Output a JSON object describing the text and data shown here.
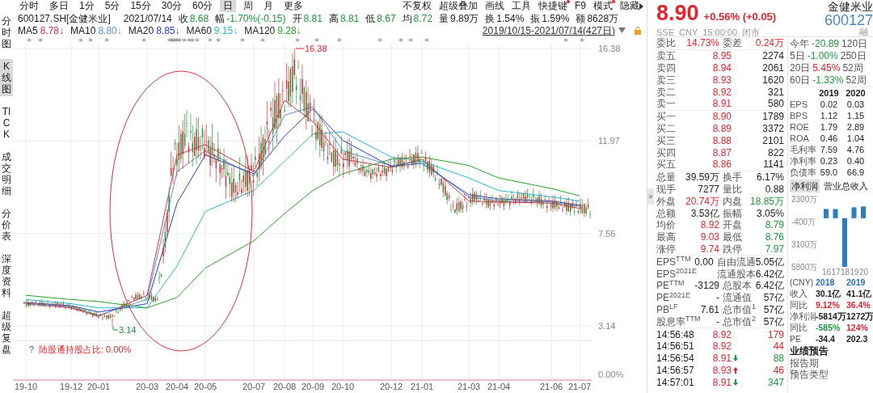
{
  "toolbar": {
    "periods": [
      {
        "label": "分时",
        "selected": false
      },
      {
        "label": "多日",
        "selected": false
      },
      {
        "label": "1分",
        "selected": false
      },
      {
        "label": "5分",
        "selected": false
      },
      {
        "label": "15分",
        "selected": false
      },
      {
        "label": "30分",
        "selected": false
      },
      {
        "label": "60分",
        "selected": false
      },
      {
        "label": "日",
        "selected": true
      },
      {
        "label": "周",
        "selected": false
      },
      {
        "label": "月",
        "selected": false
      },
      {
        "label": "更多",
        "selected": false
      }
    ],
    "tools": [
      {
        "label": "不复权",
        "dot": false,
        "caret": false
      },
      {
        "label": "超级叠加",
        "dot": false,
        "caret": false
      },
      {
        "label": "画线",
        "dot": false,
        "caret": false
      },
      {
        "label": "工具",
        "dot": false,
        "caret": false
      },
      {
        "label": "快捷键",
        "dot": true,
        "caret": false
      },
      {
        "label": "F9",
        "dot": false,
        "caret": false
      },
      {
        "label": "模式",
        "dot": true,
        "caret": false
      },
      {
        "label": "隐藏",
        "dot": false,
        "caret": true
      }
    ]
  },
  "side_tabs": [
    {
      "label": "分时图",
      "selected": false
    },
    {
      "label": "K线图",
      "selected": true
    },
    {
      "label": "TICK",
      "selected": false
    },
    {
      "label": "成交明细",
      "selected": false
    },
    {
      "label": "分价表",
      "selected": false
    },
    {
      "label": "深度资料",
      "selected": false
    },
    {
      "label": "超级复盘",
      "selected": false
    }
  ],
  "quote": {
    "symbol": "600127.SH[金健米业]",
    "date": "2021/07/14",
    "items": [
      {
        "label": "收",
        "value": "8.68",
        "color": "#1c9a3c"
      },
      {
        "label": "幅",
        "value": "-1.70%(-0.15)",
        "color": "#1c9a3c"
      },
      {
        "label": "开",
        "value": "8.81",
        "color": "#1c9a3c"
      },
      {
        "label": "高",
        "value": "8.81",
        "color": "#1c9a3c"
      },
      {
        "label": "低",
        "value": "8.67",
        "color": "#1c9a3c"
      },
      {
        "label": "均",
        "value": "8.72",
        "color": "#1c9a3c"
      },
      {
        "label": "量",
        "value": "9.89万",
        "color": "#222222"
      },
      {
        "label": "换",
        "value": "1.54%",
        "color": "#222222"
      },
      {
        "label": "振",
        "value": "1.59%",
        "color": "#222222"
      },
      {
        "label": "额",
        "value": "8628万",
        "color": "#222222"
      }
    ]
  },
  "ma": [
    {
      "label": "MA5",
      "value": "8.78↓",
      "color": "#d9304f"
    },
    {
      "label": "MA10",
      "value": "8.80↓",
      "color": "#5b8fd8"
    },
    {
      "label": "MA20",
      "value": "8.85↓",
      "color": "#2a3fc8"
    },
    {
      "label": "MA60",
      "value": "9.15↓",
      "color": "#28b8d8"
    },
    {
      "label": "MA120",
      "value": "9.28↓",
      "color": "#2aa02a"
    }
  ],
  "range": "2019/10/15-2021/07/14(427日)",
  "kline": {
    "high_label": "16.38",
    "low_label": "3.14",
    "sub_help": "?",
    "sub_text": "陆股通持股占比: 0.00%",
    "sub_tick": "0.00%",
    "chart_data": {
      "type": "line",
      "categories": [
        "19-10",
        "19-12",
        "20-01",
        "20-03",
        "20-04",
        "20-05",
        "20-07",
        "20-08",
        "20-09",
        "20-10",
        "20-12",
        "21-01",
        "21-03",
        "21-04",
        "21-06",
        "21-07"
      ],
      "ylim": [
        3.14,
        16.38
      ],
      "yticks": [
        16.38,
        11.97,
        7.55,
        3.14
      ],
      "grid": true,
      "series": [
        {
          "color": "#d9304f",
          "values": [
            4.2,
            4.0,
            3.6,
            4.6,
            11.3,
            11.8,
            10.5,
            13.9,
            12.9,
            11.1,
            10.7,
            11.1,
            9.1,
            9.05,
            9.0,
            8.75
          ]
        },
        {
          "color": "#5b8fd8",
          "values": [
            4.2,
            4.05,
            3.65,
            4.4,
            10.5,
            11.5,
            10.3,
            13.2,
            13.6,
            11.5,
            10.8,
            11.0,
            9.3,
            9.1,
            9.05,
            8.85
          ]
        },
        {
          "color": "#2a3fc8",
          "values": [
            4.25,
            4.1,
            3.8,
            4.2,
            9.0,
            11.3,
            10.4,
            12.2,
            13.5,
            12.0,
            10.75,
            10.9,
            9.4,
            9.2,
            9.1,
            8.9
          ]
        },
        {
          "color": "#28b8d8",
          "values": [
            4.4,
            4.2,
            4.0,
            4.0,
            6.0,
            8.6,
            9.6,
            11.0,
            12.3,
            12.4,
            11.2,
            11.0,
            10.2,
            9.6,
            9.3,
            9.1
          ]
        },
        {
          "color": "#2aa02a",
          "values": [
            4.6,
            4.4,
            4.3,
            4.0,
            4.5,
            5.9,
            7.2,
            8.5,
            9.6,
            10.4,
            11.1,
            11.2,
            10.8,
            10.2,
            9.7,
            9.35
          ]
        }
      ]
    }
  },
  "collapse_handle": "»",
  "header": {
    "price": "8.90",
    "change": "+0.56% (+0.05)",
    "color": "#e3262e",
    "meta": "SSE  CNY  15:00:00  闭市",
    "name": "金健米业",
    "code": "600127",
    "badge": "融"
  },
  "order_book": {
    "ratio": {
      "left": {
        "label": "委比",
        "value": "14.73%",
        "color": "#e3262e"
      },
      "right": {
        "label": "委差",
        "value": "0.24万",
        "color": "#e3262e"
      }
    },
    "asks": [
      {
        "label": "卖五",
        "price": "8.95",
        "volume": "2274",
        "color": "#e3262e"
      },
      {
        "label": "卖四",
        "price": "8.94",
        "volume": "2061",
        "color": "#e3262e"
      },
      {
        "label": "卖三",
        "price": "8.93",
        "volume": "1620",
        "color": "#e3262e"
      },
      {
        "label": "卖二",
        "price": "8.92",
        "volume": "321",
        "color": "#e3262e"
      },
      {
        "label": "卖一",
        "price": "8.91",
        "volume": "580",
        "color": "#e3262e"
      }
    ],
    "bids": [
      {
        "label": "买一",
        "price": "8.90",
        "volume": "1789",
        "color": "#e3262e"
      },
      {
        "label": "买二",
        "price": "8.89",
        "volume": "3372",
        "color": "#e3262e"
      },
      {
        "label": "买三",
        "price": "8.88",
        "volume": "2101",
        "color": "#e3262e"
      },
      {
        "label": "买四",
        "price": "8.87",
        "volume": "822",
        "color": "#e3262e"
      },
      {
        "label": "买五",
        "price": "8.86",
        "volume": "1141",
        "color": "#e3262e"
      }
    ]
  },
  "stats": [
    {
      "left": {
        "label": "总量",
        "value": "39.59万",
        "color": "#222222"
      },
      "right": {
        "label": "换手",
        "value": "6.17%",
        "color": "#222222"
      }
    },
    {
      "left": {
        "label": "现手",
        "value": "7277",
        "color": "#222222"
      },
      "right": {
        "label": "量比",
        "value": "0.88",
        "color": "#222222"
      }
    },
    {
      "left": {
        "label": "外盘",
        "value": "20.74万",
        "color": "#e3262e"
      },
      "right": {
        "label": "内盘",
        "value": "18.85万",
        "color": "#1c9a3c"
      }
    },
    {
      "left": {
        "label": "总额",
        "value": "3.53亿",
        "color": "#222222"
      },
      "right": {
        "label": "振幅",
        "value": "3.05%",
        "color": "#222222"
      }
    },
    {
      "left": {
        "label": "均价",
        "value": "8.92",
        "color": "#e3262e"
      },
      "right": {
        "label": "开盘",
        "value": "8.79",
        "color": "#1c9a3c"
      }
    },
    {
      "left": {
        "label": "最高",
        "value": "9.03",
        "color": "#e3262e"
      },
      "right": {
        "label": "最低",
        "value": "8.76",
        "color": "#1c9a3c"
      }
    },
    {
      "left": {
        "label": "涨停",
        "value": "9.74",
        "color": "#e3262e"
      },
      "right": {
        "label": "跌停",
        "value": "7.97",
        "color": "#1c9a3c"
      }
    }
  ],
  "valuation": [
    {
      "left": {
        "label": "EPS$^{TTM}$",
        "value": "0.00"
      },
      "right": {
        "label": "自由流通",
        "value": "5.05亿"
      }
    },
    {
      "left": {
        "label": "EPS$^{2021E}$"
      },
      "right": {
        "label": "流通股本",
        "value": "6.42亿"
      }
    },
    {
      "left": {
        "label": "PE$^{TTM}$",
        "value": "-3129"
      },
      "right": {
        "label": "总股本",
        "value": "6.42亿"
      }
    },
    {
      "left": {
        "label": "PE$^{2021E}$",
        "value": "-"
      },
      "right": {
        "label": "流通值",
        "value": "57亿"
      }
    },
    {
      "left": {
        "label": "PB$^{LF}$",
        "value": "7.61"
      },
      "right": {
        "label": "总市值$^{1}$",
        "value": "57亿"
      }
    },
    {
      "left": {
        "label": "股息率$^{TTM}$",
        "value": "-"
      },
      "right": {
        "label": "总市值$^{2}$",
        "value": "57亿"
      }
    }
  ],
  "trades": [
    {
      "time": "14:56:48",
      "price": "8.92",
      "arrow_up": false,
      "arrow_down": false,
      "volume": "179",
      "color": "#e3262e"
    },
    {
      "time": "14:56:51",
      "price": "8.92",
      "arrow_up": false,
      "arrow_down": false,
      "volume": "44",
      "color": "#e3262e"
    },
    {
      "time": "14:56:54",
      "price": "8.91",
      "arrow_up": false,
      "arrow_down": true,
      "volume": "88",
      "color": "#1c9a3c"
    },
    {
      "time": "14:56:57",
      "price": "8.93",
      "arrow_up": true,
      "arrow_down": false,
      "volume": "46",
      "color": "#e3262e"
    },
    {
      "time": "14:57:01",
      "price": "8.91",
      "arrow_up": false,
      "arrow_down": true,
      "volume": "347",
      "color": "#1c9a3c"
    }
  ],
  "period_returns": [
    {
      "label": "今年",
      "value": "-20.89",
      "color": "#1c9a3c",
      "label_b": "120日"
    },
    {
      "label": "5日",
      "value": "-1.00%",
      "color": "#1c9a3c",
      "label_b": "250日"
    },
    {
      "label": "20日",
      "value": "5.45%",
      "color": "#e3262e",
      "label_b": "52周"
    },
    {
      "label": "60日",
      "value": "-1.33%",
      "color": "#1c9a3c",
      "label_b": "52周"
    }
  ],
  "fin_table": {
    "columns": [
      "2019",
      "2020"
    ],
    "rows": [
      {
        "label": "EPS",
        "values": [
          "0.02",
          "0.03"
        ]
      },
      {
        "label": "BPS",
        "values": [
          "1.12",
          "1.15"
        ]
      },
      {
        "label": "ROE",
        "values": [
          "1.79",
          "2.89"
        ]
      },
      {
        "label": "ROA",
        "values": [
          "0.46",
          "1.04"
        ]
      },
      {
        "label": "毛利率",
        "values": [
          "7.59",
          "4.76"
        ]
      },
      {
        "label": "净利率",
        "values": [
          "0.23",
          "0.40"
        ]
      },
      {
        "label": "负债率",
        "values": [
          "59.0",
          "66.9"
        ]
      }
    ]
  },
  "profit_tabs": [
    {
      "label": "净利润",
      "selected": true
    },
    {
      "label": "营业总收入",
      "selected": false
    }
  ],
  "profit_chart": {
    "chart_data": {
      "type": "bar",
      "categories": [
        "16",
        "17",
        "18",
        "19",
        "20"
      ],
      "series": [
        {
          "color": "#2a7fc0",
          "values": [
            1100,
            1100,
            -5800,
            1300,
            1400
          ]
        }
      ],
      "ylim": [
        -5800,
        2300
      ],
      "yticks": [
        {
          "value": 2300,
          "label": "2300万"
        },
        {
          "value": -400,
          "label": "-400万"
        },
        {
          "value": -3100,
          "label": "3100万"
        },
        {
          "value": -5800,
          "label": "5800万"
        }
      ]
    }
  },
  "cny_table": {
    "head": "(CNY)",
    "columns": [
      "2018",
      "2019"
    ],
    "rows": [
      {
        "label": "收入",
        "values": [
          {
            "text": "30.1亿",
            "color": "#222222"
          },
          {
            "text": "41.1亿",
            "color": "#222222"
          }
        ]
      },
      {
        "label": "同比",
        "values": [
          {
            "text": "9.12%",
            "color": "#e3262e"
          },
          {
            "text": "36.4%",
            "color": "#e3262e"
          }
        ]
      },
      {
        "label": "净利润",
        "values": [
          {
            "text": "-5814万",
            "color": "#222222"
          },
          {
            "text": "1272万",
            "color": "#222222"
          }
        ]
      },
      {
        "label": "同比",
        "values": [
          {
            "text": "-585%",
            "color": "#1c9a3c"
          },
          {
            "text": "124%",
            "color": "#e3262e"
          }
        ]
      },
      {
        "label": "PE",
        "values": [
          {
            "text": "-34.4",
            "color": "#222222"
          },
          {
            "text": "202.3",
            "color": "#222222"
          }
        ]
      }
    ]
  },
  "forecast": {
    "title": "业绩预告",
    "rows": [
      "报告期",
      "预告类型"
    ]
  }
}
